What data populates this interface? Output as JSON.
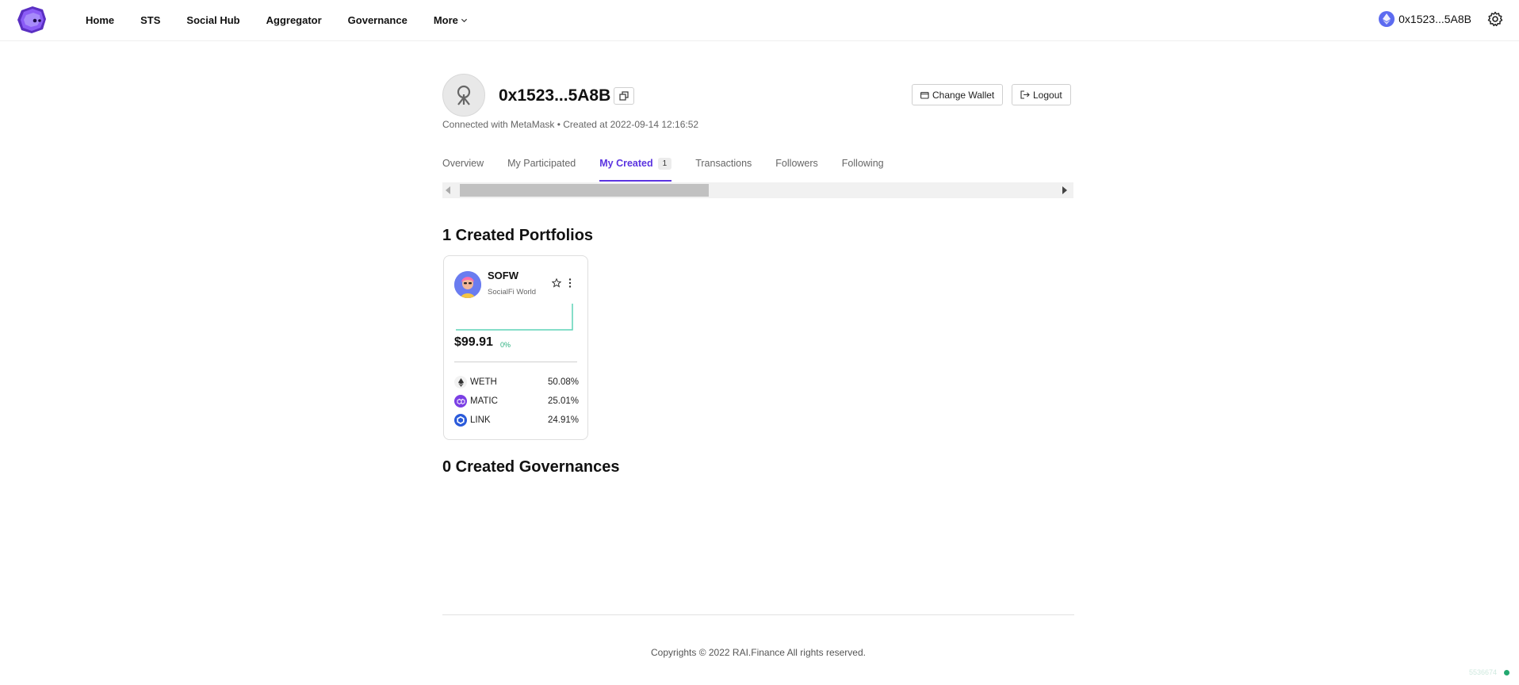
{
  "nav": {
    "items": [
      "Home",
      "STS",
      "Social Hub",
      "Aggregator",
      "Governance"
    ],
    "more_label": "More",
    "wallet_address": "0x1523...5A8B"
  },
  "profile": {
    "address": "0x1523...5A8B",
    "meta": "Connected with MetaMask • Created at 2022-09-14 12:16:52",
    "change_wallet_label": "Change Wallet",
    "logout_label": "Logout"
  },
  "tabs": [
    {
      "label": "Overview",
      "active": false
    },
    {
      "label": "My Participated",
      "active": false
    },
    {
      "label": "My Created",
      "active": true,
      "badge": "1"
    },
    {
      "label": "Transactions",
      "active": false
    },
    {
      "label": "Followers",
      "active": false
    },
    {
      "label": "Following",
      "active": false
    }
  ],
  "portfolios": {
    "title": "1 Created Portfolios",
    "cards": [
      {
        "symbol": "SOFW",
        "name": "SocialFi World",
        "price": "$99.91",
        "change": "0%",
        "assets": [
          {
            "symbol": "WETH",
            "percent": "50.08%",
            "icon": "eth-icon",
            "color": "#f2f2f2"
          },
          {
            "symbol": "MATIC",
            "percent": "25.01%",
            "icon": "matic-icon",
            "color": "#7b3fe4"
          },
          {
            "symbol": "LINK",
            "percent": "24.91%",
            "icon": "link-icon",
            "color": "#2a5ada"
          }
        ]
      }
    ]
  },
  "governances": {
    "title": "0 Created Governances"
  },
  "footer": {
    "copyright": "Copyrights © 2022 RAI.Finance All rights reserved.",
    "version": "5536674"
  },
  "colors": {
    "accent": "#5b34e0",
    "positive": "#2bb07f",
    "status": "#23a870"
  }
}
